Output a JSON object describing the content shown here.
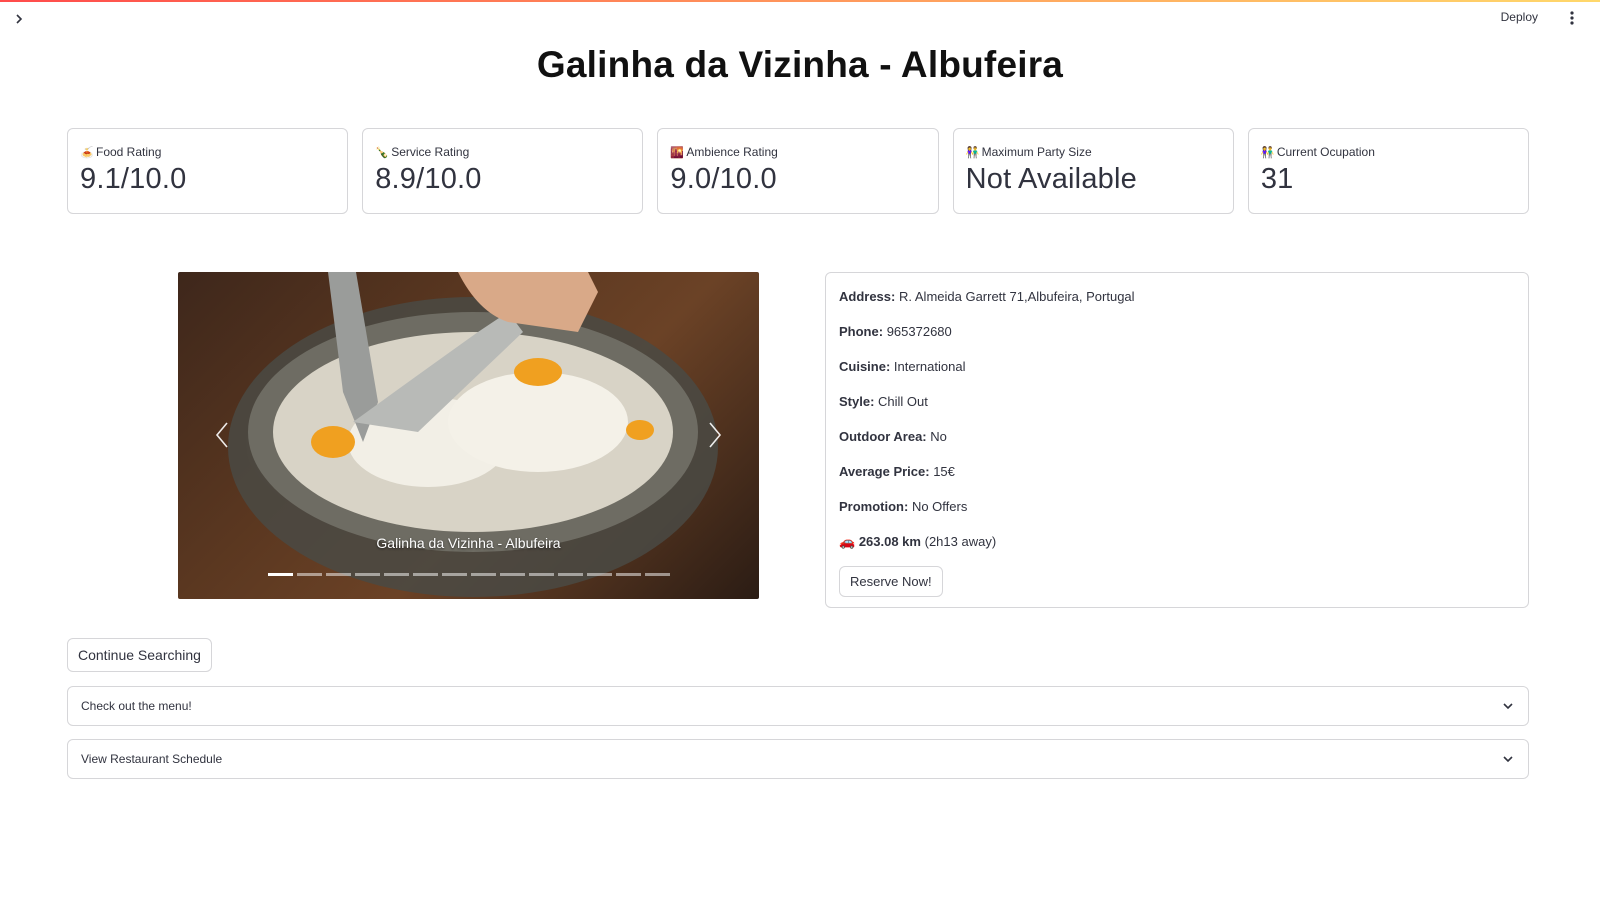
{
  "header": {
    "deploy_label": "Deploy",
    "title": "Galinha da Vizinha - Albufeira"
  },
  "metrics": [
    {
      "emoji": "🍝",
      "label": "Food Rating",
      "value": "9.1/10.0"
    },
    {
      "emoji": "🍾",
      "label": "Service Rating",
      "value": "8.9/10.0"
    },
    {
      "emoji": "🌇",
      "label": "Ambience Rating",
      "value": "9.0/10.0"
    },
    {
      "emoji": "👫",
      "label": "Maximum Party Size",
      "value": "Not Available"
    },
    {
      "emoji": "👫",
      "label": "Current Ocupation",
      "value": "31"
    }
  ],
  "carousel": {
    "caption": "Galinha da Vizinha - Albufeira",
    "slide_count": 14,
    "active_slide": 1
  },
  "details": {
    "address_label": "Address:",
    "address_value": "R. Almeida Garrett 71,Albufeira, Portugal",
    "phone_label": "Phone:",
    "phone_value": "965372680",
    "cuisine_label": "Cuisine:",
    "cuisine_value": "International",
    "style_label": "Style:",
    "style_value": "Chill Out",
    "outdoor_label": "Outdoor Area:",
    "outdoor_value": "No",
    "price_label": "Average Price:",
    "price_value": "15€",
    "promotion_label": "Promotion:",
    "promotion_value": "No Offers",
    "distance_emoji": "🚗",
    "distance_value": "263.08 km",
    "distance_time": "(2h13 away)"
  },
  "buttons": {
    "reserve_label": "Reserve Now!",
    "continue_label": "Continue Searching"
  },
  "expanders": [
    {
      "label": "Check out the menu!"
    },
    {
      "label": "View Restaurant Schedule"
    }
  ],
  "icons": {
    "sidebar_toggle": "chevron-right-icon",
    "main_menu": "kebab-menu-icon",
    "carousel_prev": "chevron-left-icon",
    "carousel_next": "chevron-right-icon",
    "expander": "chevron-down-icon"
  },
  "colors": {
    "accent_gradient_start": "#ff4b4b",
    "accent_gradient_end": "#ffd86b",
    "border": "#d6d6d9",
    "text": "#31333f"
  }
}
